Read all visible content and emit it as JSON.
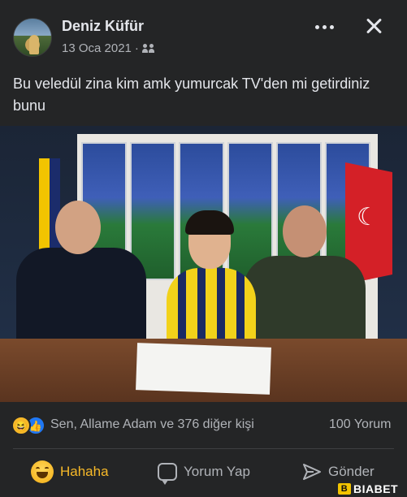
{
  "header": {
    "author_name": "Deniz Küfür",
    "date": "13 Oca 2021",
    "separator": "·"
  },
  "post": {
    "text": "Bu veledül zina kim amk yumurcak TV'den mi getirdiniz bunu"
  },
  "reactions": {
    "summary": "Sen, Allame Adam ve 376 diğer kişi",
    "comments": "100 Yorum",
    "icons": [
      "haha-icon",
      "like-icon"
    ]
  },
  "actions": {
    "haha_label": "Hahaha",
    "comment_label": "Yorum Yap",
    "send_label": "Gönder"
  },
  "watermark": {
    "text": "BIABET"
  },
  "colors": {
    "background": "#242526",
    "text_primary": "#e4e6eb",
    "text_secondary": "#b0b3b8",
    "haha_accent": "#f7b928",
    "like_blue": "#2078f4"
  }
}
